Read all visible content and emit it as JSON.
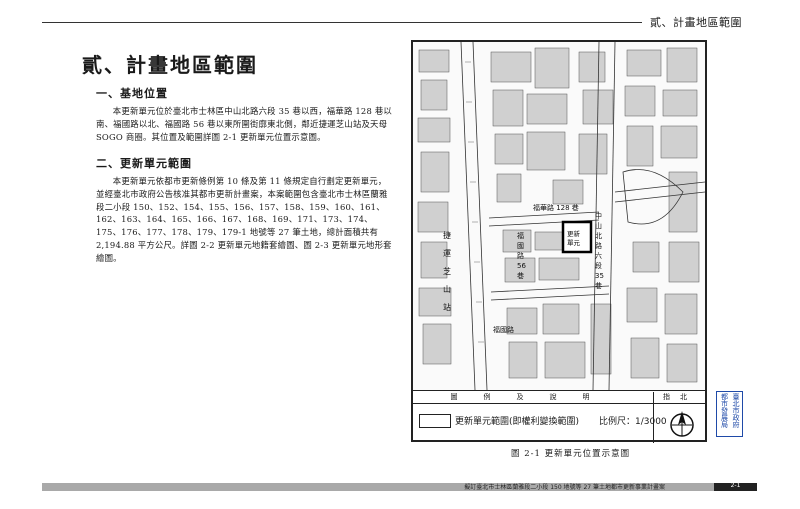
{
  "header": {
    "title": "貳、計畫地區範圍"
  },
  "section": {
    "title": "貳、計畫地區範圍"
  },
  "sub1": {
    "heading": "一、基地位置",
    "text": "本更新單元位於臺北市士林區中山北路六段 35 巷以西，福華路 128 巷以南、福國路以北、福國路 56 巷以東所圍街廓東北側，鄰近捷運芝山站及天母 SOGO 商圈。其位置及範圍詳圖 2-1 更新單元位置示意圖。"
  },
  "sub2": {
    "heading": "二、更新單元範圍",
    "text": "本更新單元依都市更新條例第 10 條及第 11 條規定自行劃定更新單元，並經臺北市政府公告核准其都市更新計畫案，本案範圍包含臺北市士林區蘭雅段二小段 150、152、154、155、156、157、158、159、160、161、162、163、164、165、166、167、168、169、171、173、174、175、176、177、178、179、179-1 地號等 27 筆土地，總計面積共有 2,194.88 平方公尺。詳圖 2-2 更新單元地籍套繪圖、圖 2-3 更新單元地形套繪圖。"
  },
  "map": {
    "labels": {
      "fuhua": "福華路 128 巷",
      "zhongshan": "中山北路六段 35 巷",
      "unit": "更新單元",
      "fuguo56": "福國路 56 巷",
      "fuguo": "福國路",
      "mrt": "捷運芝山站"
    }
  },
  "legend": {
    "header_left": "圖例及說明",
    "header_right": "指北",
    "item_label": "更新單元範圍(即權利變換範圍)",
    "scale": "比例尺：1/3000"
  },
  "caption": "圖 2-1 更新單元位置示意圖",
  "stamp": [
    "臺北市政府",
    "都市發展局"
  ],
  "footer": {
    "text": "擬訂臺北市士林區蘭雅段二小段 150 地號等 27 筆土地都市更新事業計畫案",
    "page": "2-1"
  }
}
